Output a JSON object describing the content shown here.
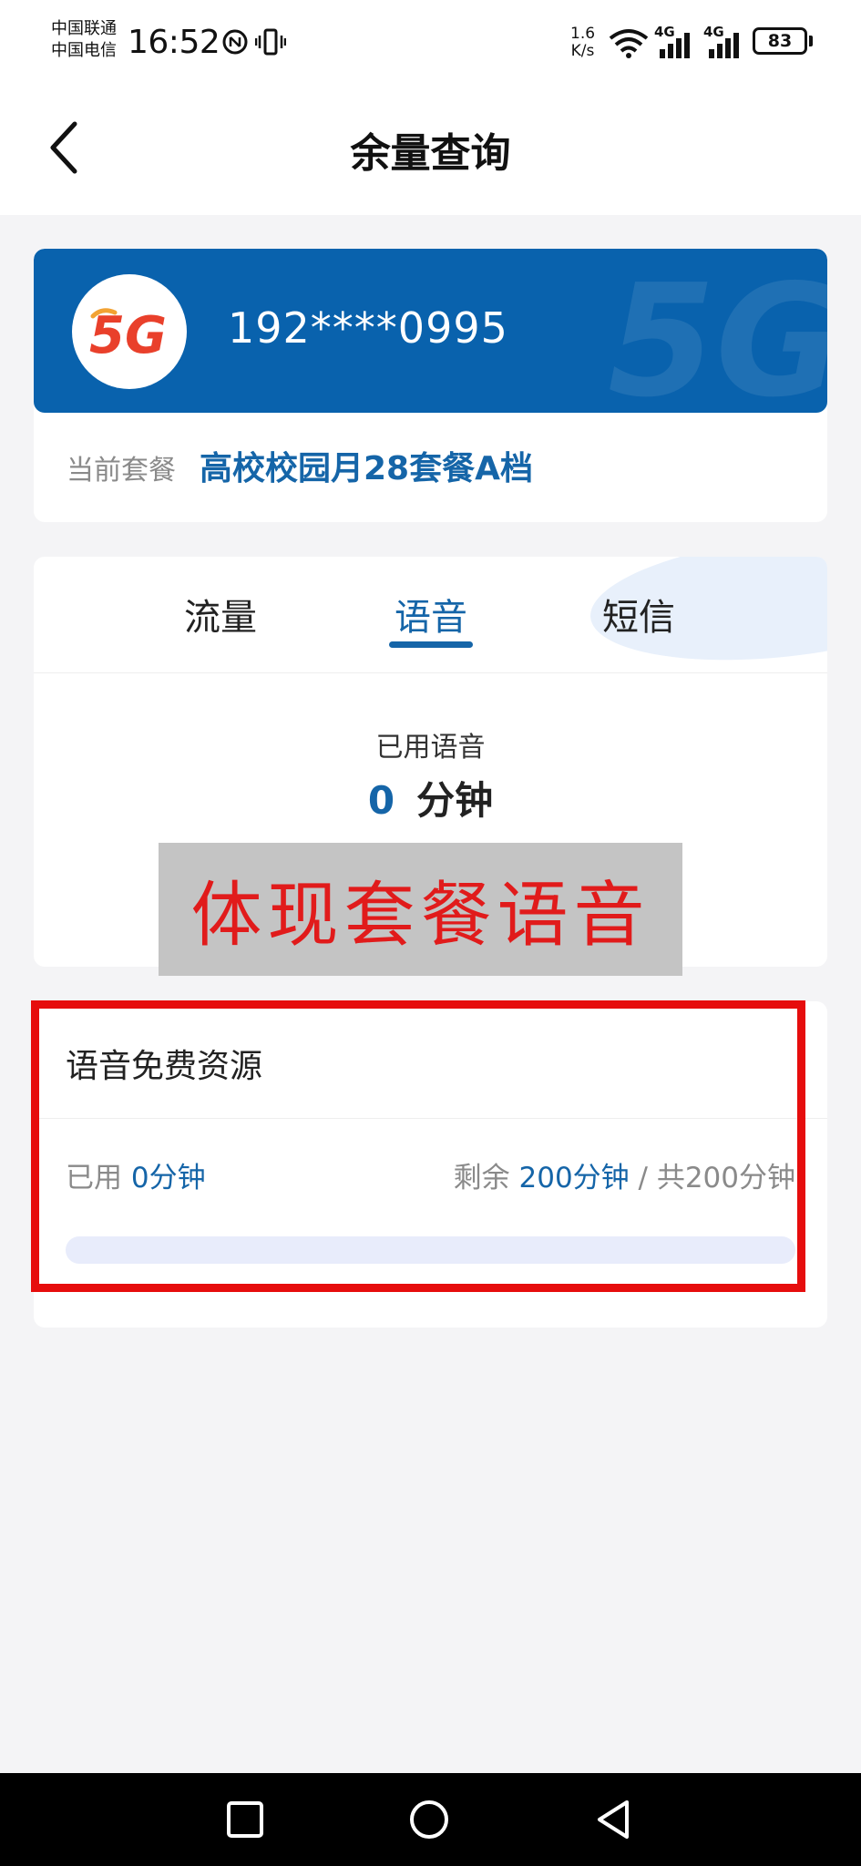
{
  "status_bar": {
    "carrier_1": "中国联通",
    "carrier_2": "中国电信",
    "time": "16:52",
    "net_speed_value": "1.6",
    "net_speed_unit": "K/s",
    "network_1": "4G",
    "network_2": "4G",
    "battery": "83"
  },
  "header": {
    "title": "余量查询",
    "back_icon": "chevron-left-icon"
  },
  "account": {
    "logo_text": "5G",
    "phone": "192****0995",
    "plan_label": "当前套餐",
    "plan_name": "高校校园月28套餐A档"
  },
  "tabs": [
    {
      "label": "流量",
      "active": false
    },
    {
      "label": "语音",
      "active": true
    },
    {
      "label": "短信",
      "active": false
    }
  ],
  "usage_summary": {
    "label": "已用语音",
    "value": "0",
    "unit": "分钟"
  },
  "annotation": {
    "text": "体现套餐语音"
  },
  "free_resource": {
    "title": "语音免费资源",
    "used_label": "已用",
    "used_value": "0分钟",
    "remaining_label": "剩余",
    "remaining_value": "200分钟",
    "total_text": "/ 共200分钟",
    "used_fraction": 0
  },
  "colors": {
    "brand_blue": "#0962ad",
    "accent_blue": "#1565a8",
    "highlight_red": "#e60d0d"
  }
}
